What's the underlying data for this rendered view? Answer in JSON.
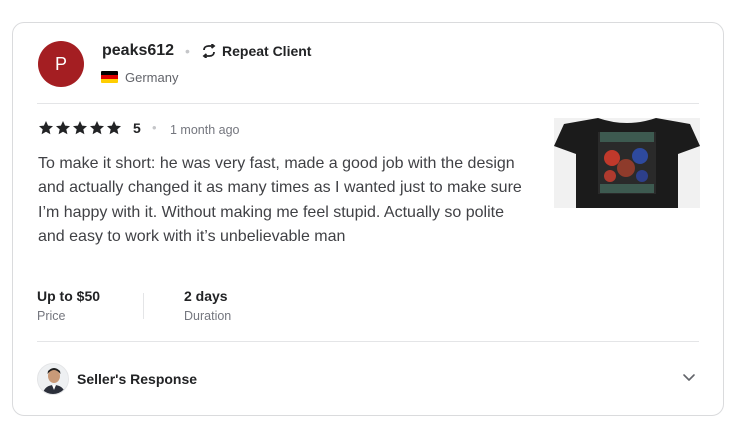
{
  "reviewer": {
    "avatar_letter": "P",
    "username": "peaks612",
    "separator": "•",
    "badge": "Repeat Client",
    "country": "Germany"
  },
  "rating": {
    "stars": 5,
    "value": "5",
    "separator": "•",
    "time_ago": "1 month ago"
  },
  "review_text": "To make it short: he was very fast, made a good job with the design and actually changed it as many times as I wanted just to make sure I’m happy with it. Without making me feel stupid. Actually so polite and easy to work with it’s unbelievable man",
  "stats": {
    "price": {
      "value": "Up to $50",
      "label": "Price"
    },
    "duration": {
      "value": "2 days",
      "label": "Duration"
    }
  },
  "seller_response": {
    "label": "Seller's Response"
  },
  "colors": {
    "avatar": "#a41e22",
    "star": "#222325",
    "border": "#dadbdd"
  },
  "icons": {
    "repeat": "repeat-icon",
    "star": "star-icon",
    "chevron": "chevron-down-icon",
    "flag": "germany-flag-icon"
  }
}
